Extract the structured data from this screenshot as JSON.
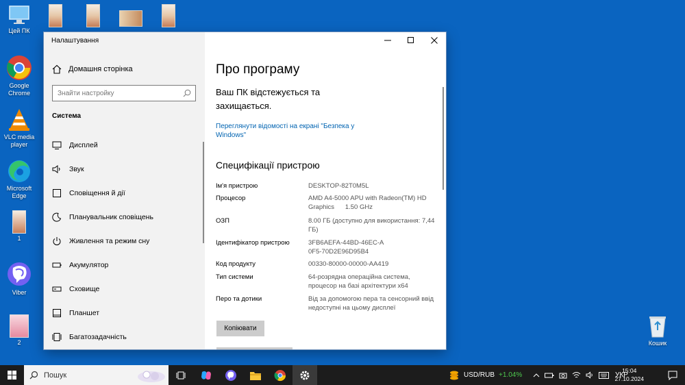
{
  "desktop": {
    "icons": [
      {
        "label": "Цей ПК",
        "icon": "this-pc-icon"
      },
      {
        "label": "Google Chrome",
        "icon": "chrome-icon"
      },
      {
        "label": "VLC media player",
        "icon": "vlc-icon"
      },
      {
        "label": "Microsoft Edge",
        "icon": "edge-icon"
      },
      {
        "label": "1",
        "icon": "image-file-icon"
      },
      {
        "label": "Viber",
        "icon": "viber-icon"
      },
      {
        "label": "2",
        "icon": "image-file-icon"
      },
      {
        "label": "Кошик",
        "icon": "recycle-bin-icon"
      }
    ]
  },
  "window": {
    "title": "Налаштування",
    "controls": [
      "minimize",
      "maximize",
      "close"
    ]
  },
  "sidebar": {
    "home_label": "Домашня сторінка",
    "search_placeholder": "Знайти настройку",
    "section_title": "Система",
    "items": [
      {
        "label": "Дисплей",
        "icon": "display-icon"
      },
      {
        "label": "Звук",
        "icon": "speaker-icon"
      },
      {
        "label": "Сповіщення й дії",
        "icon": "notification-icon"
      },
      {
        "label": "Планувальник сповіщень",
        "icon": "moon-icon"
      },
      {
        "label": "Живлення та режим сну",
        "icon": "power-icon"
      },
      {
        "label": "Акумулятор",
        "icon": "battery-icon"
      },
      {
        "label": "Сховище",
        "icon": "storage-icon"
      },
      {
        "label": "Планшет",
        "icon": "tablet-icon"
      },
      {
        "label": "Багатозадачність",
        "icon": "multitask-icon"
      }
    ]
  },
  "content": {
    "title": "Про програму",
    "protection_text": "Ваш ПК відстежується та захищається.",
    "security_link": "Переглянути відомості на екрані \"Безпека у Windows\"",
    "spec_title": "Специфікації пристрою",
    "specs": [
      {
        "key": "Ім'я пристрою",
        "value": "DESKTOP-82T0M5L"
      },
      {
        "key": "Процесор",
        "value": "AMD A4-5000 APU with Radeon(TM) HD Graphics      1.50 GHz"
      },
      {
        "key": "ОЗП",
        "value": "8.00 ГБ (доступно для використання: 7,44 ГБ)"
      },
      {
        "key": "Ідентифікатор пристрою",
        "value": "3FB6AEFA-44BD-46EC-A0F5-70D2E96D95B4"
      },
      {
        "key": "Код продукту",
        "value": "00330-80000-00000-AA419"
      },
      {
        "key": "Тип системи",
        "value": "64-розрядна операційна система, процесор на базі архітектури x64"
      },
      {
        "key": "Перо та дотики",
        "value": "Від за допомогою пера та сенсорний ввід недоступні на цьому дисплеї"
      }
    ],
    "copy_button": "Копіювати"
  },
  "taskbar": {
    "search_label": "Пошук",
    "apps": [
      "task-view-icon",
      "copilot-icon",
      "viber-icon",
      "file-explorer-icon",
      "chrome-icon",
      "settings-icon"
    ],
    "ticker_label": "USD/RUB",
    "ticker_change": "+1.04%",
    "language": "УКР",
    "time": "15:04",
    "date": "27.10.2024"
  },
  "colors": {
    "desktop_bg": "#0a64c0",
    "link": "#0063b1",
    "ticker_positive": "#4ec94e"
  }
}
